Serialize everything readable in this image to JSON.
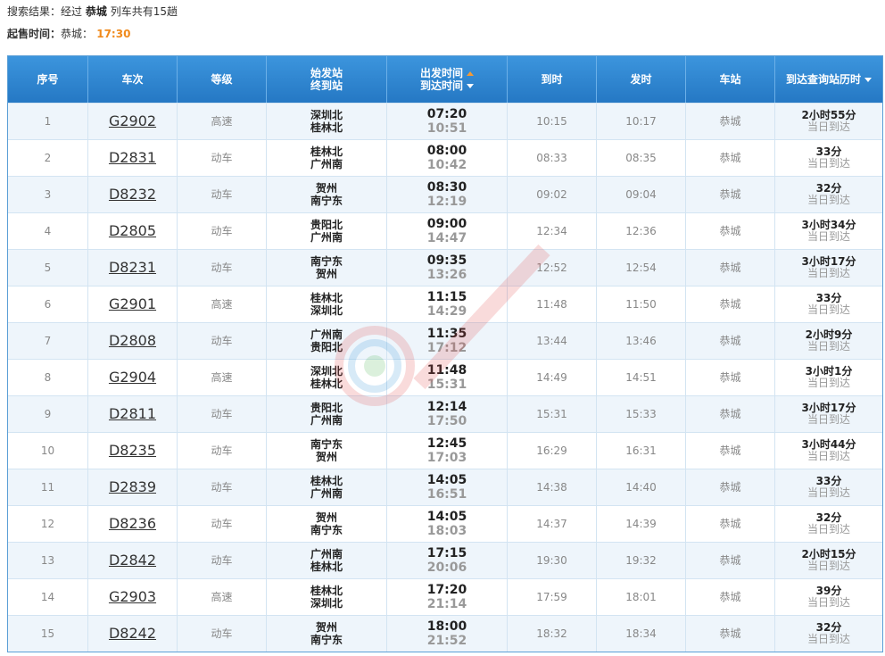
{
  "summary": {
    "prefix": "搜索结果：经过",
    "station": "恭城",
    "suffix": "列车共有15趟"
  },
  "sale_time": {
    "label": "起售时间：",
    "station": "恭城：",
    "time": "17:30"
  },
  "header": {
    "seq": "序号",
    "train": "车次",
    "grade": "等级",
    "start_station": "始发站",
    "end_station": "终到站",
    "depart_time": "出发时间",
    "arrive_time": "到达时间",
    "arrive": "到时",
    "depart": "发时",
    "station": "车站",
    "duration": "到达查询站历时"
  },
  "colors": {
    "header_bg": "#2f86d0",
    "accent_orange": "#f08a1c",
    "row_alt": "#eef5fb"
  },
  "rows": [
    {
      "seq": "1",
      "train": "G2902",
      "grade": "高速",
      "from": "深圳北",
      "to": "桂林北",
      "dep": "07:20",
      "arr": "10:51",
      "at": "10:15",
      "dt": "10:17",
      "station": "恭城",
      "dur": "2小时55分",
      "day": "当日到达"
    },
    {
      "seq": "2",
      "train": "D2831",
      "grade": "动车",
      "from": "桂林北",
      "to": "广州南",
      "dep": "08:00",
      "arr": "10:42",
      "at": "08:33",
      "dt": "08:35",
      "station": "恭城",
      "dur": "33分",
      "day": "当日到达"
    },
    {
      "seq": "3",
      "train": "D8232",
      "grade": "动车",
      "from": "贺州",
      "to": "南宁东",
      "dep": "08:30",
      "arr": "12:19",
      "at": "09:02",
      "dt": "09:04",
      "station": "恭城",
      "dur": "32分",
      "day": "当日到达"
    },
    {
      "seq": "4",
      "train": "D2805",
      "grade": "动车",
      "from": "贵阳北",
      "to": "广州南",
      "dep": "09:00",
      "arr": "14:47",
      "at": "12:34",
      "dt": "12:36",
      "station": "恭城",
      "dur": "3小时34分",
      "day": "当日到达"
    },
    {
      "seq": "5",
      "train": "D8231",
      "grade": "动车",
      "from": "南宁东",
      "to": "贺州",
      "dep": "09:35",
      "arr": "13:26",
      "at": "12:52",
      "dt": "12:54",
      "station": "恭城",
      "dur": "3小时17分",
      "day": "当日到达"
    },
    {
      "seq": "6",
      "train": "G2901",
      "grade": "高速",
      "from": "桂林北",
      "to": "深圳北",
      "dep": "11:15",
      "arr": "14:29",
      "at": "11:48",
      "dt": "11:50",
      "station": "恭城",
      "dur": "33分",
      "day": "当日到达"
    },
    {
      "seq": "7",
      "train": "D2808",
      "grade": "动车",
      "from": "广州南",
      "to": "贵阳北",
      "dep": "11:35",
      "arr": "17:12",
      "at": "13:44",
      "dt": "13:46",
      "station": "恭城",
      "dur": "2小时9分",
      "day": "当日到达"
    },
    {
      "seq": "8",
      "train": "G2904",
      "grade": "高速",
      "from": "深圳北",
      "to": "桂林北",
      "dep": "11:48",
      "arr": "15:31",
      "at": "14:49",
      "dt": "14:51",
      "station": "恭城",
      "dur": "3小时1分",
      "day": "当日到达"
    },
    {
      "seq": "9",
      "train": "D2811",
      "grade": "动车",
      "from": "贵阳北",
      "to": "广州南",
      "dep": "12:14",
      "arr": "17:50",
      "at": "15:31",
      "dt": "15:33",
      "station": "恭城",
      "dur": "3小时17分",
      "day": "当日到达"
    },
    {
      "seq": "10",
      "train": "D8235",
      "grade": "动车",
      "from": "南宁东",
      "to": "贺州",
      "dep": "12:45",
      "arr": "17:03",
      "at": "16:29",
      "dt": "16:31",
      "station": "恭城",
      "dur": "3小时44分",
      "day": "当日到达"
    },
    {
      "seq": "11",
      "train": "D2839",
      "grade": "动车",
      "from": "桂林北",
      "to": "广州南",
      "dep": "14:05",
      "arr": "16:51",
      "at": "14:38",
      "dt": "14:40",
      "station": "恭城",
      "dur": "33分",
      "day": "当日到达"
    },
    {
      "seq": "12",
      "train": "D8236",
      "grade": "动车",
      "from": "贺州",
      "to": "南宁东",
      "dep": "14:05",
      "arr": "18:03",
      "at": "14:37",
      "dt": "14:39",
      "station": "恭城",
      "dur": "32分",
      "day": "当日到达"
    },
    {
      "seq": "13",
      "train": "D2842",
      "grade": "动车",
      "from": "广州南",
      "to": "桂林北",
      "dep": "17:15",
      "arr": "20:06",
      "at": "19:30",
      "dt": "19:32",
      "station": "恭城",
      "dur": "2小时15分",
      "day": "当日到达"
    },
    {
      "seq": "14",
      "train": "G2903",
      "grade": "高速",
      "from": "桂林北",
      "to": "深圳北",
      "dep": "17:20",
      "arr": "21:14",
      "at": "17:59",
      "dt": "18:01",
      "station": "恭城",
      "dur": "39分",
      "day": "当日到达"
    },
    {
      "seq": "15",
      "train": "D8242",
      "grade": "动车",
      "from": "贺州",
      "to": "南宁东",
      "dep": "18:00",
      "arr": "21:52",
      "at": "18:32",
      "dt": "18:34",
      "station": "恭城",
      "dur": "32分",
      "day": "当日到达"
    }
  ]
}
